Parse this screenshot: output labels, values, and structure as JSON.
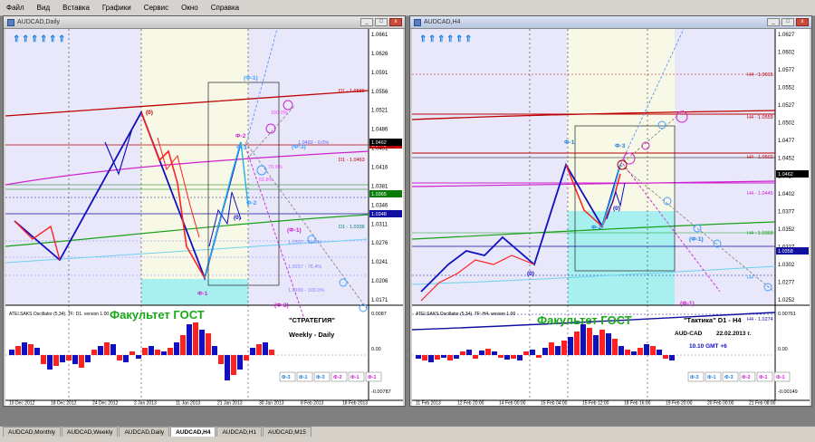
{
  "menu": [
    "Файл",
    "Вид",
    "Вставка",
    "Графики",
    "Сервис",
    "Окно",
    "Справка"
  ],
  "left_window": {
    "title": "AUDCAD,Daily",
    "price_labels": [
      "1.0661",
      "1.0626",
      "1.0591",
      "1.0556",
      "1.0521",
      "1.0486",
      "1.0451",
      "1.0416",
      "1.0381",
      "1.0346",
      "1.0311",
      "1.0276",
      "1.0241",
      "1.0206",
      "1.0171"
    ],
    "current_price": "1.0462",
    "level_labels": [
      "D1 - 1.0589",
      "1.0482 - 0.0%",
      "D1 - 1.0463",
      "D1 - 1.0336",
      "1.0302 - 61.8%",
      "1.0257 - 76.4%",
      "1.0189 - 100.0%",
      "70.0%",
      "61.8%",
      "100.0%"
    ],
    "wave_labels": [
      "(0)",
      "(Ф-1)",
      "Ф-2",
      "Ф-3",
      "Ф-1",
      "(0)",
      "(Ф-1)",
      "(Ф-3)",
      "(Ф-3)"
    ],
    "watermark": "Факультет ГОСТ",
    "oscillator_label": "ATEI.SAKS.Oscillator (5,34). TF: D1. version 1.00",
    "osc_scale": [
      "0.0087",
      "0.00",
      "-0.00787"
    ],
    "note_title": "\"СТРАТЕГИЯ\"",
    "note_sub": "Weekly - Daily",
    "buttons": [
      "Ф-3",
      "Ф-1",
      "Ф-3",
      "Ф-2",
      "Ф-1",
      "Ф-1"
    ],
    "dates": [
      "10 Dec 2012",
      "18 Dec 2012",
      "24 Dec 2012",
      "2 Jan 2013",
      "11 Jan 2013",
      "21 Jan 2013",
      "30 Jan 2013",
      "8 Feb 2013",
      "18 Feb 2013"
    ],
    "level_price_tags": [
      "1.0479",
      "1.0365",
      "1.0348"
    ]
  },
  "right_window": {
    "title": "AUDCAD,H4",
    "price_labels": [
      "1.0627",
      "1.0602",
      "1.0577",
      "1.0552",
      "1.0527",
      "1.0502",
      "1.0477",
      "1.0452",
      "1.0427",
      "1.0402",
      "1.0377",
      "1.0352",
      "1.0327",
      "1.0302",
      "1.0277",
      "1.0252"
    ],
    "current_price": "1.0462",
    "level_labels": [
      "H4 - 1.0615",
      "H4 - 1.0559",
      "H4 - 1.0502",
      "H4 - 1.0445",
      "H4 - 1.0368",
      "H4 - 1.0274",
      "H4 -"
    ],
    "wave_labels": [
      "Ф-1",
      "Ф-3",
      "(0)",
      "Ф-2",
      "(0)",
      "(Ф-1)",
      "(Ф-1)"
    ],
    "watermark": "Факультет ГОСТ",
    "oscillator_label": "ATEI.SAKS.Oscillator (5,34). TF: H4. version 1.00",
    "osc_scale": [
      "0.00761",
      "0.00",
      "-0.00149"
    ],
    "note_title": "\"Тактика\"  D1 - H4",
    "note_pair": "AUD-CAD",
    "note_date": "22.02.2013  г.",
    "note_time": "10.10  GMT +6",
    "buttons": [
      "Ф-3",
      "Ф-1",
      "Ф-3",
      "Ф-2",
      "Ф-1",
      "Ф-1"
    ],
    "dates": [
      "11 Feb 2013",
      "12 Feb 20:00",
      "14 Feb 00:00",
      "15 Feb 04:00",
      "15 Feb 12:00",
      "18 Feb 16:00",
      "19 Feb 20:00",
      "20 Feb 00:00",
      "21 Feb 08:00"
    ],
    "level_price_tags": [
      "1.0358"
    ]
  },
  "tabs": [
    "AUDCAD,Monthly",
    "AUDCAD,Weekly",
    "AUDCAD,Daily",
    "AUDCAD,H4",
    "AUDCAD,H1",
    "AUDCAD,M15"
  ],
  "active_tab": "AUDCAD,H4",
  "colors": {
    "bull": "#ff2020",
    "bear": "#1010c0",
    "watermark": "#18a818",
    "cyan_zone": "#a8f0f0"
  }
}
